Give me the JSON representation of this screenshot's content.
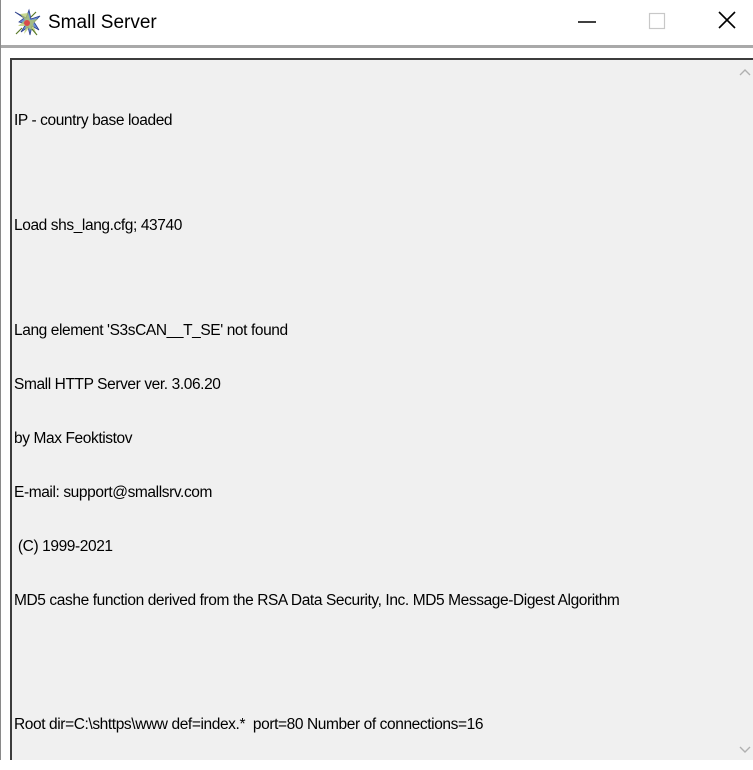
{
  "window": {
    "title": "Small Server",
    "icon": "small-server-app-icon",
    "controls": {
      "minimize_icon": "minimize-icon",
      "maximize_icon": "maximize-icon",
      "close_icon": "close-icon"
    }
  },
  "log": {
    "lines": [
      "IP - country base loaded",
      "Load shs_lang.cfg; 43740",
      "Lang element 'S3sCAN__T_SE' not found",
      "Small HTTP Server ver. 3.06.20",
      "by Max Feoktistov",
      "E-mail: support@smallsrv.com",
      " (C) 1999-2021",
      "MD5 cashe function derived from the RSA Data Security, Inc. MD5 Message-Digest Algorithm",
      "Root dir=C:\\shttps\\www def=index.*  port=80 Number of connections=16"
    ]
  },
  "scrollbar": {
    "up_icon": "scroll-up-arrow-icon",
    "down_icon": "scroll-down-arrow-icon"
  },
  "colors": {
    "client_background": "#f0f0f0",
    "titlebar_background": "#ffffff",
    "text": "#000000"
  }
}
